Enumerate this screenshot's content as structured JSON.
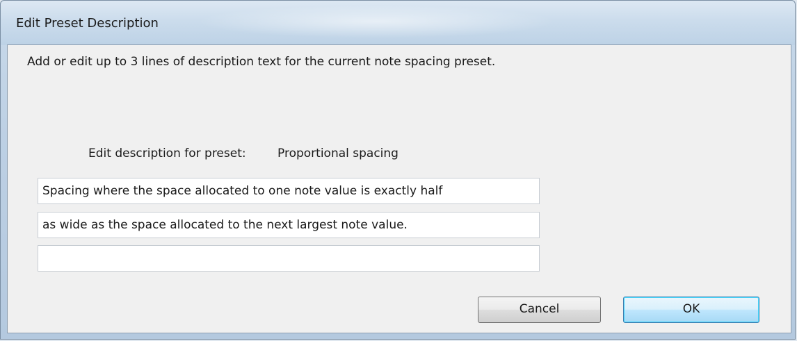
{
  "window": {
    "title": "Edit Preset Description"
  },
  "dialog": {
    "instruction": "Add or edit up to 3 lines of description text for the current note spacing preset.",
    "preset_label": "Edit description for preset:",
    "preset_name": "Proportional spacing",
    "lines": [
      "Spacing where the space allocated to one note value is exactly half",
      "as wide as the space allocated to the next largest note value.",
      ""
    ]
  },
  "buttons": {
    "cancel": "Cancel",
    "ok": "OK"
  }
}
